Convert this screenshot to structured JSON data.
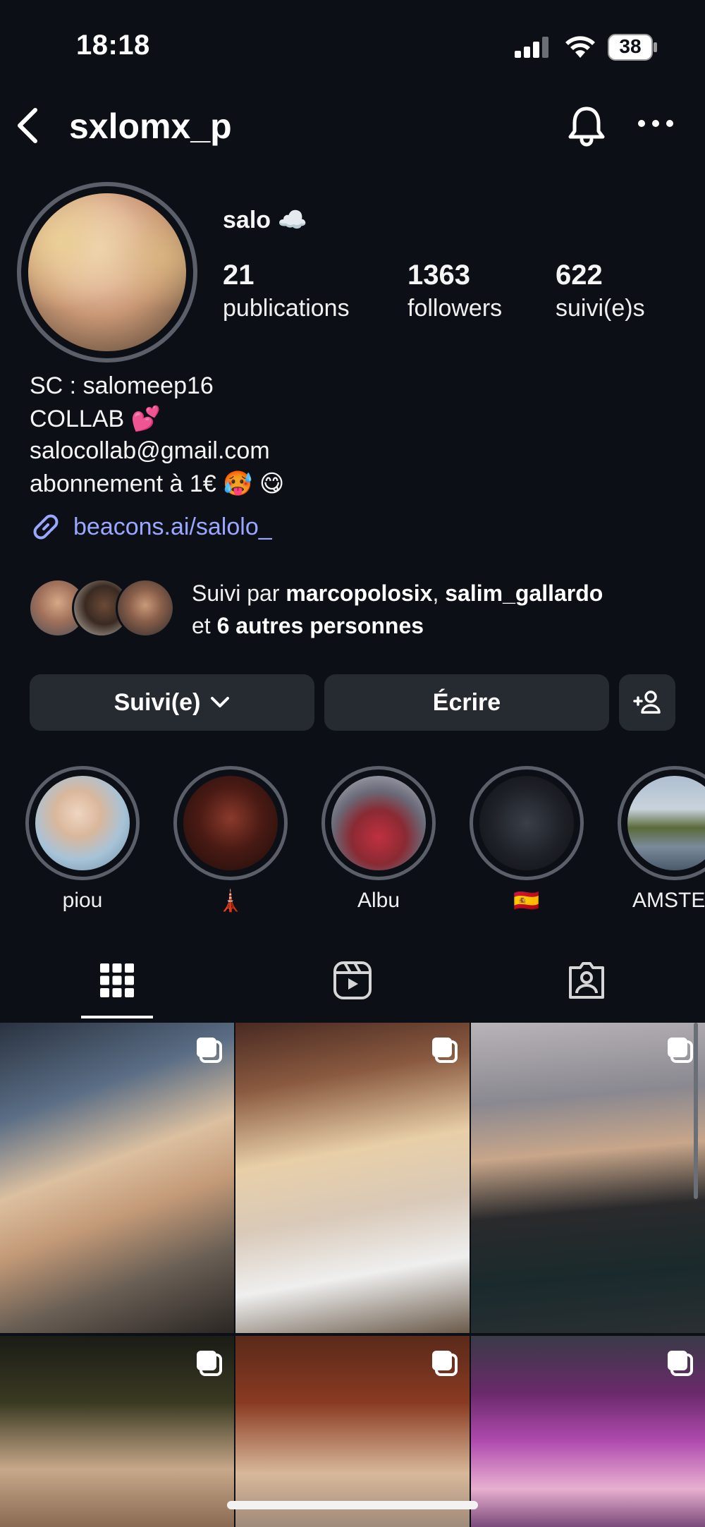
{
  "status_bar": {
    "time": "18:18",
    "battery": "38"
  },
  "header": {
    "username": "sxlomx_p"
  },
  "profile": {
    "display_name": "salo ☁️",
    "stats": [
      {
        "value": "21",
        "label": "publications"
      },
      {
        "value": "1363",
        "label": "followers"
      },
      {
        "value": "622",
        "label": "suivi(e)s"
      }
    ],
    "bio": [
      "SC : salomeep16",
      "COLLAB 💕",
      "salocollab@gmail.com",
      "abonnement à 1€ 🥵 😋"
    ],
    "link": "beacons.ai/salolo_"
  },
  "followed_by": {
    "prefix": "Suivi par ",
    "user1": "marcopolosix",
    "separator": ", ",
    "user2": "salim_gallardo",
    "line2_prefix": "et ",
    "others": "6 autres personnes"
  },
  "actions": {
    "follow_label": "Suivi(e)",
    "message_label": "Écrire"
  },
  "highlights": [
    {
      "label": "piou"
    },
    {
      "label": "🗼"
    },
    {
      "label": "Albu"
    },
    {
      "label": "🇪🇸"
    },
    {
      "label": "AMSTE"
    }
  ],
  "colors": {
    "background": "#0c1016",
    "button": "#262a31",
    "link": "#9aa7ff",
    "ring": "#5a5f69"
  }
}
